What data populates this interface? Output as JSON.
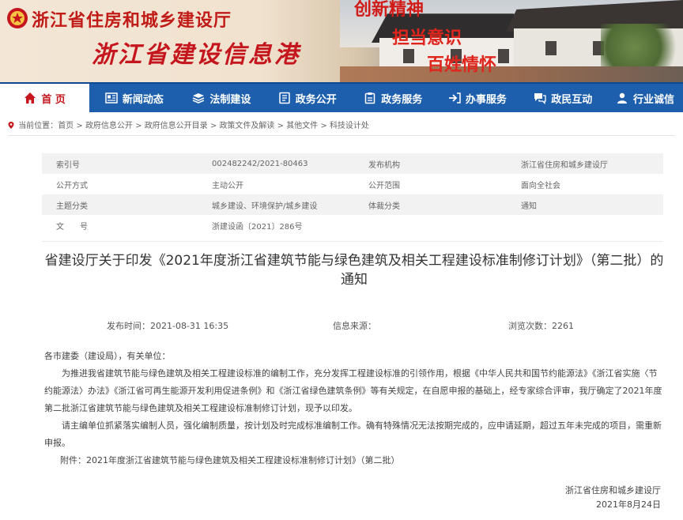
{
  "banner": {
    "department": "浙江省住房和城乡建设厅",
    "portal": "浙江省建设信息港",
    "slogans": [
      "创新精神",
      "担当意识",
      "百姓情怀"
    ]
  },
  "nav": {
    "items": [
      {
        "label": "首  页",
        "icon": "home-icon"
      },
      {
        "label": "新闻动态",
        "icon": "newspaper-icon"
      },
      {
        "label": "法制建设",
        "icon": "layers-icon"
      },
      {
        "label": "政务公开",
        "icon": "document-icon"
      },
      {
        "label": "政务服务",
        "icon": "clipboard-icon"
      },
      {
        "label": "办事服务",
        "icon": "arrow-icon"
      },
      {
        "label": "政民互动",
        "icon": "chat-icon"
      },
      {
        "label": "行业诚信",
        "icon": "person-icon"
      }
    ]
  },
  "breadcrumb": {
    "prefix": "当前位置：",
    "items": [
      "首页",
      "政府信息公开",
      "政府信息公开目录",
      "政策文件及解读",
      "其他文件",
      "科技设计处"
    ],
    "separator": " > "
  },
  "meta": {
    "rows": [
      {
        "k1": "索引号",
        "v1": "002482242/2021-80463",
        "k2": "发布机构",
        "v2": "浙江省住房和城乡建设厅"
      },
      {
        "k1": "公开方式",
        "v1": "主动公开",
        "k2": "公开范围",
        "v2": "面向全社会"
      },
      {
        "k1": "主题分类",
        "v1": "城乡建设、环境保护/城乡建设",
        "k2": "体裁分类",
        "v2": "通知"
      },
      {
        "k1": "文　　号",
        "v1": "浙建设函〔2021〕286号",
        "k2": "",
        "v2": ""
      }
    ]
  },
  "article": {
    "title": "省建设厅关于印发《2021年度浙江省建筑节能与绿色建筑及相关工程建设标准制修订计划》（第二批）的通知",
    "publish_label": "发布时间：",
    "publish_time": "2021-08-31 16:35",
    "source_label": "信息来源：",
    "source": "",
    "views_label": "浏览次数：",
    "views": "2261",
    "salutation": "各市建委（建设局），有关单位：",
    "para1": "为推进我省建筑节能与绿色建筑及相关工程建设标准的编制工作，充分发挥工程建设标准的引领作用，根据《中华人民共和国节约能源法》《浙江省实施〈节约能源法〉办法》《浙江省可再生能源开发利用促进条例》和《浙江省绿色建筑条例》等有关规定，在自愿申报的基础上，经专家综合评审，我厅确定了2021年度第二批浙江省建筑节能与绿色建筑及相关工程建设标准制修订计划，现予以印发。",
    "para2": "请主编单位抓紧落实编制人员，强化编制质量，按计划及时完成标准编制工作。确有特殊情况无法按期完成的，应申请延期，超过五年未完成的项目，需重新申报。",
    "attachment": "附件：2021年度浙江省建筑节能与绿色建筑及相关工程建设标准制修订计划》（第二批）",
    "signer": "浙江省住房和城乡建设厅",
    "sign_date": "2021年8月24日"
  }
}
